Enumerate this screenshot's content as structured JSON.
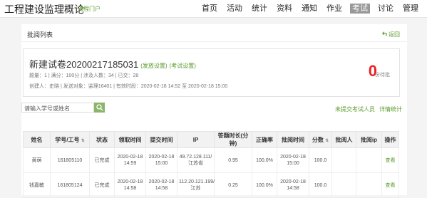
{
  "brand": {
    "title": "工程建设监理概论",
    "subtitle": "课程门户"
  },
  "nav": [
    "首页",
    "活动",
    "统计",
    "资料",
    "通知",
    "作业",
    "考试",
    "讨论",
    "管理"
  ],
  "panel": {
    "title": "批阅列表",
    "back": "返回"
  },
  "exam": {
    "title": "新建试卷20200217185031",
    "link1": "(发放设置)",
    "link2": "(考试设置)",
    "meta1": "题量：1 | 满分：100分 | 涉及人数：34 | 已交：28",
    "meta2": "创建人：史晓 | 发送对象：监理16401 | 有效时段：2020-02-18 14:52 至 2020-02-18 15:00",
    "pending_count": "0",
    "pending_label": "份待批"
  },
  "search": {
    "placeholder": "请输入学号或姓名"
  },
  "links": {
    "unsubmitted": "未提交考试人员",
    "detail": "详情统计"
  },
  "table": {
    "headers": [
      "姓名",
      "学号/工号",
      "状态",
      "领取时间",
      "提交时间",
      "IP",
      "答题时长(分钟)",
      "正确率",
      "批阅时间",
      "分数",
      "批阅人",
      "批阅ip",
      "操作"
    ],
    "rows": [
      {
        "name": "黄萌",
        "id": "161805110",
        "status": "已完成",
        "get_time": "2020-02-18 14:59",
        "submit_time": "2020-02-18 15:00",
        "ip": "49.72.128.111/江苏省",
        "duration": "0.95",
        "accuracy": "100.0%",
        "review_time": "2020-02-18 15:00",
        "score": "100.0",
        "reviewer": "",
        "review_ip": "",
        "action": "查看"
      },
      {
        "name": "钱嘉敏",
        "id": "161805124",
        "status": "已完成",
        "get_time": "2020-02-18 14:58",
        "submit_time": "2020-02-18 14:58",
        "ip": "112.20.121.199/江苏",
        "duration": "0.25",
        "accuracy": "100.0%",
        "review_time": "2020-02-18 14:58",
        "score": "100.0",
        "reviewer": "",
        "review_ip": "",
        "action": "查看"
      }
    ]
  },
  "colors": {
    "accent": "#5a9a2c",
    "count": "#ee2222",
    "nav_active": "#999999"
  }
}
